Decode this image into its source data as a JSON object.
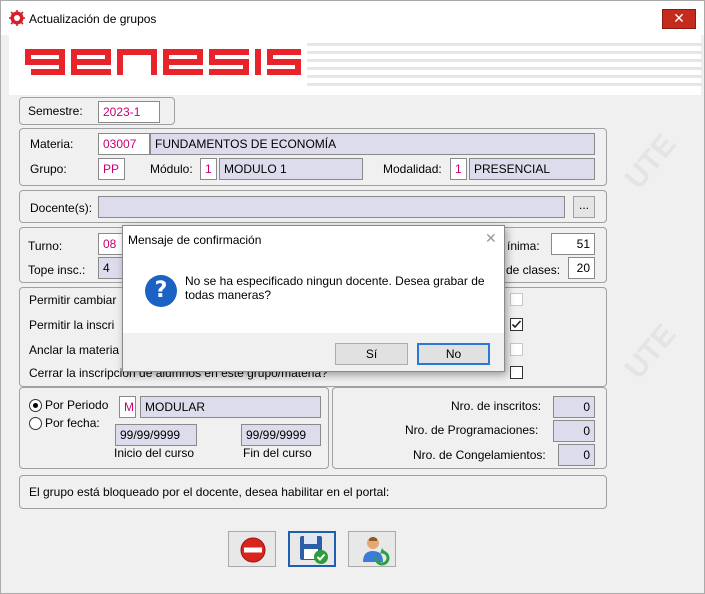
{
  "window": {
    "title": "Actualización de grupos",
    "close_glyph": "✕",
    "app_icon": "genesis-app-icon"
  },
  "banner": {
    "logo_text": "GENESIS",
    "logo_color": "#e8232a",
    "watermark": "UTE"
  },
  "semestre": {
    "label": "Semestre:",
    "value": "2023-1"
  },
  "materia": {
    "label": "Materia:",
    "code": "03007",
    "name": "FUNDAMENTOS DE ECONOMÍA",
    "grupo_label": "Grupo:",
    "grupo": "PP",
    "modulo_label": "Módulo:",
    "modulo_code": "1",
    "modulo_name": "MODULO 1",
    "modalidad_label": "Modalidad:",
    "modalidad_code": "1",
    "modalidad_name": "PRESENCIAL"
  },
  "docente": {
    "label": "Docente(s):",
    "value": "",
    "browse_label": "..."
  },
  "turno": {
    "turno_label": "Turno:",
    "turno_value": "08",
    "tope_label": "Tope insc.:",
    "tope_value": "4",
    "minima_label": "ínima:",
    "minima_value": "51",
    "clases_label": "de clases:",
    "clases_value": "20"
  },
  "options": {
    "opt1": "Permitir cambiar",
    "opt2": "Permitir la inscri",
    "opt3": "Anclar la materia",
    "opt4": "Cerrar la inscripción de alumnos en este grupo/materia?",
    "checks": [
      false,
      true,
      false,
      false
    ]
  },
  "periodo": {
    "por_periodo_label": "Por Periodo",
    "por_fecha_label": "Por fecha:",
    "periodo_code": "M",
    "periodo_name": "MODULAR",
    "inicio_value": "99/99/9999",
    "fin_value": "99/99/9999",
    "inicio_label": "Inicio del curso",
    "fin_label": "Fin del curso"
  },
  "stats": {
    "inscritos_label": "Nro. de inscritos:",
    "inscritos_value": "0",
    "programaciones_label": "Nro. de Programaciones:",
    "programaciones_value": "0",
    "congelamientos_label": "Nro. de Congelamientos:",
    "congelamientos_value": "0"
  },
  "bloqueo": {
    "text": "El grupo está bloqueado por el docente, desea habilitar en el portal:"
  },
  "toolbar": {
    "buttons": [
      "cancel-icon",
      "save-icon",
      "user-refresh-icon"
    ]
  },
  "dialog": {
    "title": "Mensaje de confirmación",
    "close_glyph": "✕",
    "icon_glyph": "?",
    "message_line1": "No se ha especificado ningun docente. Desea grabar de",
    "message_line2": "todas maneras?",
    "yes_label": "Sí",
    "no_label": "No"
  }
}
